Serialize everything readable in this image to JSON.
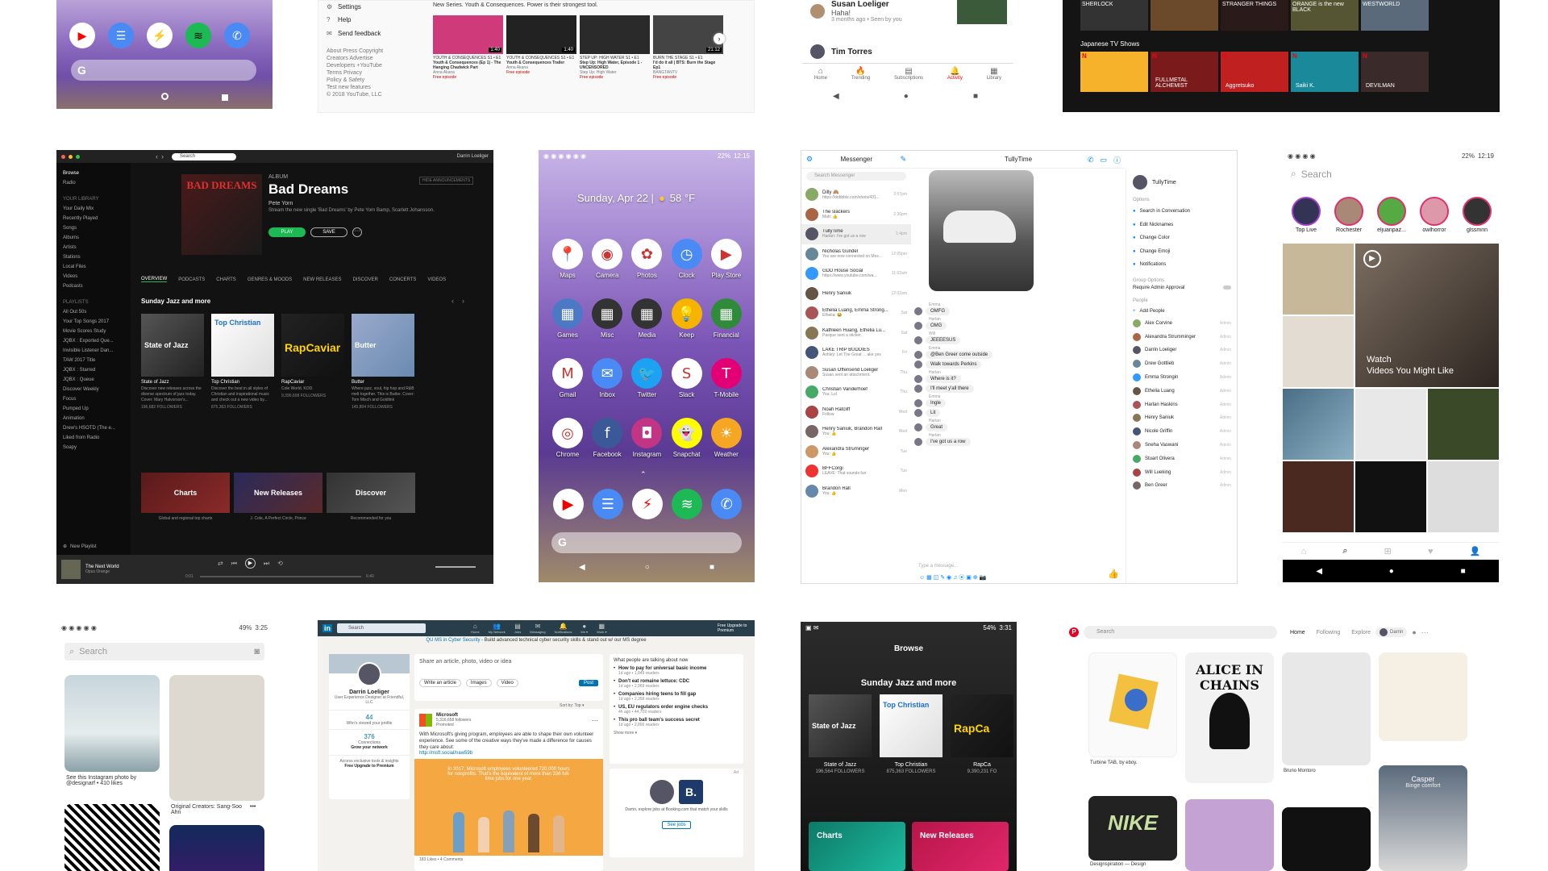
{
  "tile_a": {
    "dock": [
      "youtube-icon",
      "messages-icon",
      "messenger-icon",
      "spotify-icon",
      "phone-icon"
    ]
  },
  "tile_b": {
    "menu": [
      "Settings",
      "Help",
      "Send feedback"
    ],
    "footer": [
      "About  Press  Copyright",
      "Creators  Advertise",
      "Developers  +YouTube",
      "Terms  Privacy",
      "Policy & Safety",
      "Test new features",
      "© 2018 YouTube, LLC"
    ],
    "intro": "New Series. Youth & Consequences. Power is their strongest tool.",
    "videos": [
      {
        "title": "YOUTH & CONSEQUENCES S1 • E1",
        "sub": "Youth & Consequences (Ep 1) - The Hanging Chadwick Part",
        "by": "Anna Akana",
        "badge": "Free episode",
        "dur": "1:40"
      },
      {
        "title": "YOUTH & CONSEQUENCES S1 • E1",
        "sub": "Youth & Consequences Trailer",
        "by": "Anna Akana",
        "badge": "Free episode",
        "dur": "1:40"
      },
      {
        "title": "STEP UP: HIGH WATER S1 • E1",
        "sub": "Step Up: High Water, Episode 1 - UNCENSORED",
        "by": "Step Up: High Water",
        "badge": "Free episode",
        "dur": ""
      },
      {
        "title": "BURN THE STAGE S1 • E1",
        "sub": "I'd do it all | BTS: Burn the Stage Ep1",
        "by": "BANGTANTV",
        "badge": "Free episode",
        "dur": "21:12"
      }
    ]
  },
  "tile_c": {
    "top_name": "Susan Loeliger",
    "top_msg": "Haha!",
    "top_time": "3 months ago • Seen by you",
    "second_name": "Tim Torres",
    "nav": [
      "Home",
      "Trending",
      "Subscriptions",
      "Activity",
      "Library"
    ]
  },
  "tile_d": {
    "row1": [
      "SHERLOCK",
      "",
      "STRANGER THINGS",
      "ORANGE is the new BLACK",
      "WESTWORLD"
    ],
    "section": "Japanese TV Shows",
    "row2": [
      "",
      "FULLMETAL ALCHEMIST",
      "Aggretsuko",
      "Saiki K.",
      "DEVILMAN"
    ]
  },
  "spotify": {
    "search_ph": "Search",
    "user": "Darrin Loeliger",
    "left": [
      "Browse",
      "Radio"
    ],
    "library_h": "YOUR LIBRARY",
    "library": [
      "Your Daily Mix",
      "Recently Played",
      "Songs",
      "Albums",
      "Artists",
      "Stations",
      "Local Files",
      "Videos",
      "Podcasts"
    ],
    "playlists_h": "PLAYLISTS",
    "playlists": [
      "All Out 50s",
      "Your Top Songs 2017",
      "Movie Scores Study",
      "JQBX : Exported Que...",
      "Invisible Listener Dan...",
      "TAW 2017 Title",
      "JQBX : Starred",
      "JQBX : Queue",
      "Discover Weekly",
      "Focus",
      "Pumped Up",
      "Animation",
      "Drew's HSOTD (The e...",
      "Liked from Radio",
      "Soapy"
    ],
    "new_playlist": "New Playlist",
    "album_label": "ALBUM",
    "album_title": "Bad Dreams",
    "album_art_text": "BAD DREAMS",
    "artist": "Pete Yorn",
    "desc": "Stream the new single 'Bad Dreams' by Pete Yorn Bamp, Scarlett Johansson.",
    "play": "PLAY",
    "save": "SAVE",
    "hide": "HIDE ANNOUNCEMENTS",
    "tabs": [
      "OVERVIEW",
      "PODCASTS",
      "CHARTS",
      "GENRES & MOODS",
      "NEW RELEASES",
      "DISCOVER",
      "CONCERTS",
      "VIDEOS"
    ],
    "section": "Sunday Jazz and more",
    "cards": [
      {
        "name": "State of Jazz",
        "desc": "Discover new releases across the diverse spectrum of jazz today. Cover: Mary Halvorson's...",
        "f": "196,682 FOLLOWERS"
      },
      {
        "name": "Top Christian",
        "desc": "Discover the best in all styles of Christian and inspirational music and check out a new video by...",
        "f": "875,363 FOLLOWERS"
      },
      {
        "name": "RapCaviar",
        "desc": "Cole World. KOD.",
        "f": "9,390,608 FOLLOWERS"
      },
      {
        "name": "Butter",
        "desc": "Where jazz, soul, hip hop and R&B melt together. This is Butter. Cover: Tom Misch and Goldlink",
        "f": "145,804 FOLLOWERS"
      }
    ],
    "banners": [
      {
        "t": "Charts",
        "s": "Global and regional top charts"
      },
      {
        "t": "New Releases",
        "s": "J. Cole, A Perfect Circle, Prince"
      },
      {
        "t": "Discover",
        "s": "Recommended for you"
      }
    ],
    "now_title": "The Next World",
    "now_artist": "Opus Orange",
    "t_start": "0:01",
    "t_end": "6:40"
  },
  "android": {
    "status_time": "12:15",
    "status_batt": "22%",
    "date": "Sunday, Apr 22 |",
    "weather": "58 °F",
    "apps": [
      {
        "n": "Maps",
        "c": "#fff",
        "i": "maps-icon",
        "g": "📍"
      },
      {
        "n": "Camera",
        "c": "#fff",
        "i": "camera-icon",
        "g": "◉"
      },
      {
        "n": "Photos",
        "c": "#fff",
        "i": "photos-icon",
        "g": "✿"
      },
      {
        "n": "Clock",
        "c": "#4a8af4",
        "i": "clock-icon",
        "g": "◷"
      },
      {
        "n": "Play Store",
        "c": "#fff",
        "i": "play-store-icon",
        "g": "▶"
      },
      {
        "n": "Games",
        "c": "#4b79c6",
        "i": "games-folder-icon",
        "g": "▦"
      },
      {
        "n": "Misc",
        "c": "#333",
        "i": "misc-folder-icon",
        "g": "▦"
      },
      {
        "n": "Media",
        "c": "#333",
        "i": "media-folder-icon",
        "g": "▦"
      },
      {
        "n": "Keep",
        "c": "#f6b400",
        "i": "keep-icon",
        "g": "💡"
      },
      {
        "n": "Financial",
        "c": "#2f8a3a",
        "i": "financial-folder-icon",
        "g": "▦"
      },
      {
        "n": "Gmail",
        "c": "#fff",
        "i": "gmail-icon",
        "g": "M"
      },
      {
        "n": "Inbox",
        "c": "#4a8af4",
        "i": "inbox-icon",
        "g": "✉"
      },
      {
        "n": "Twitter",
        "c": "#1da1f2",
        "i": "twitter-icon",
        "g": "🐦"
      },
      {
        "n": "Slack",
        "c": "#fff",
        "i": "slack-icon",
        "g": "S"
      },
      {
        "n": "T-Mobile",
        "c": "#e20074",
        "i": "tmobile-icon",
        "g": "T"
      },
      {
        "n": "Chrome",
        "c": "#fff",
        "i": "chrome-icon",
        "g": "◎"
      },
      {
        "n": "Facebook",
        "c": "#3b5998",
        "i": "facebook-icon",
        "g": "f"
      },
      {
        "n": "Instagram",
        "c": "#c13584",
        "i": "instagram-icon",
        "g": "◘"
      },
      {
        "n": "Snapchat",
        "c": "#fffc00",
        "i": "snapchat-icon",
        "g": "👻"
      },
      {
        "n": "Weather",
        "c": "#f5a623",
        "i": "weather-icon",
        "g": "☀"
      }
    ],
    "dock": [
      {
        "c": "#fff",
        "i": "youtube-icon",
        "g": "▶"
      },
      {
        "c": "#4a8af4",
        "i": "messages-icon",
        "g": "☰"
      },
      {
        "c": "#fff",
        "i": "messenger-icon",
        "g": "⚡"
      },
      {
        "c": "#1db954",
        "i": "spotify-icon",
        "g": "≋"
      },
      {
        "c": "#4a8af4",
        "i": "phone-icon",
        "g": "✆"
      }
    ]
  },
  "messenger": {
    "title": "Messenger",
    "search_ph": "Search Messenger",
    "convo_title": "TullyTime",
    "convos": [
      {
        "n": "Dilly 🙈",
        "m": "https://dribbble.com/shots/431...",
        "t": "2:57pm"
      },
      {
        "n": "The slackers",
        "m": "Matt: 👍",
        "t": "2:36pm"
      },
      {
        "n": "TullyTime",
        "m": "Harlan: I've got us a row",
        "t": "1:4pm"
      },
      {
        "n": "Nicholas Gundel",
        "m": "You are now connected on Mes...",
        "t": "12:05pm"
      },
      {
        "n": "GDD House Social",
        "m": "https://www.youtube.com/wa...",
        "t": "11:02am"
      },
      {
        "n": "Henry Saniuk",
        "m": "",
        "t": "12:02am"
      },
      {
        "n": "Ethelia Luang, Emma Strong...",
        "m": "Ethelia: 😂",
        "t": "Sat"
      },
      {
        "n": "Kathleen Huang, Ethelia Lu...",
        "m": "Pasque sent a sticker.",
        "t": "Sat"
      },
      {
        "n": "LAKE TRIP BUDDIES",
        "m": "Ashley: Let The Great ... ake yes",
        "t": "Fri"
      },
      {
        "n": "Susan Offensend Loeliger",
        "m": "Susan sent an attachment.",
        "t": "Thu"
      },
      {
        "n": "Christian Vanderhoef",
        "m": "You: Lol",
        "t": "Thu"
      },
      {
        "n": "Noah Ratcliff",
        "m": "Follow",
        "t": "Wed"
      },
      {
        "n": "Henry Saniuk, Brandon Rall",
        "m": "You: 👍",
        "t": "Wed"
      },
      {
        "n": "Alexandra Struminger",
        "m": "You: 👍",
        "t": "Tue"
      },
      {
        "n": "BFFCorgi",
        "m": "LEAVE: That sounds fun",
        "t": "Tue"
      },
      {
        "n": "Brandon Rall",
        "m": "You: 👍",
        "t": "Mon"
      }
    ],
    "chat": [
      {
        "who": "Emma",
        "text": "OMFG"
      },
      {
        "who": "Harlan",
        "text": "OMG"
      },
      {
        "who": "Will",
        "text": "JEEEESUS"
      },
      {
        "who": "Emma",
        "text": "@Ben Greer come outside"
      },
      {
        "who": "",
        "text": "Walk towards Perkins"
      },
      {
        "who": "Harlan",
        "text": "Where is it?"
      },
      {
        "who": "",
        "text": "I'll meet y'all there"
      },
      {
        "who": "Emma",
        "text": "Ingle"
      },
      {
        "who": "",
        "text": "Lit"
      },
      {
        "who": "Harlan",
        "text": "Great"
      },
      {
        "who": "Harlan",
        "text": "I've got us a row"
      }
    ],
    "compose_ph": "Type a message...",
    "info_name": "TullyTime",
    "options_h": "Options",
    "options": [
      "Search in Conversation",
      "Edit Nicknames",
      "Change Color",
      "Change Emoji",
      "Notifications"
    ],
    "group_h": "Group Options",
    "require": "Require Admin Approval",
    "people_h": "People",
    "add": "Add People",
    "people": [
      "Alex Corvine",
      "Alexandra Strumminger",
      "Darrin Loeliger",
      "Drew Gottlieb",
      "Emma Strongin",
      "Ethelia Luang",
      "Harlan Haskins",
      "Henry Saniuk",
      "Nicole Griffin",
      "Sneha Vaswani",
      "Stuart Olivera",
      "Will Lueking",
      "Ben Greer"
    ],
    "admin": "Admin"
  },
  "instagram": {
    "status_batt": "22%",
    "status_time": "12:19",
    "search_ph": "Search",
    "stories": [
      "Top Live",
      "Rochester",
      "eljuanpaz...",
      "owlhorror",
      "glssmnn"
    ],
    "watch_1": "Watch",
    "watch_2": "Videos You Might Like",
    "nav": [
      "home-icon",
      "search-icon",
      "add-icon",
      "heart-icon",
      "profile-icon"
    ]
  },
  "pinterest_android": {
    "status_batt": "49%",
    "status_time": "3:25",
    "search_ph": "Search",
    "cap1": "See this Instagram photo by @designarf • 410 likes",
    "cap2": "Original Creators: Sang-Soo Ahn",
    "more": "•••"
  },
  "linkedin": {
    "search_ph": "Search",
    "nav": [
      "Home",
      "My Network",
      "Jobs",
      "Messaging",
      "Notifications",
      "Me ▾",
      "Work ▾"
    ],
    "upgrade": "Free Upgrade to Premium",
    "ad_prefix": "QU MS in Cyber Security",
    "ad_text": "- Build advanced technical cyber security skills & stand out w/ our MS degree",
    "ad_label": "Ad",
    "name": "Darrin Loeliger",
    "role": "User Experience Designer at Friendful, LLC",
    "views_n": "44",
    "views_l": "Who's viewed your profile",
    "conn_n": "376",
    "conn_l": "Connections",
    "conn_s": "Grow your network",
    "premium_1": "Access exclusive tools & insights",
    "premium_2": "Free Upgrade to Premium",
    "share_ph": "Share an article, photo, video or idea",
    "write": "Write an article",
    "images": "Images",
    "video": "Video",
    "post": "Post",
    "sort": "Sort by: Top ▾",
    "co": "Microsoft",
    "co_f": "5,316,658 followers",
    "co_p": "Promoted",
    "post_text": "With Microsoft's giving program, employees are able to shape their own volunteer experience. See some of the creative ways they've made a difference for causes they care about:",
    "post_link": "http://msft.social/naw59b",
    "img_text": "In 2017, Microsoft employees volunteered 720,000 hours for nonprofits. That's the equivalent of more than 336 full-time jobs for one year.",
    "news_h": "What people are talking about now",
    "news": [
      {
        "t": "How to pay for universal basic income",
        "s": "1d ago • 1,849 readers"
      },
      {
        "t": "Don't eat romaine lettuce: CDC",
        "s": "1d ago • 2,969 readers"
      },
      {
        "t": "Companies hiring teens to fill gap",
        "s": "1d ago • 2,358 readers"
      },
      {
        "t": "US, EU regulators order engine checks",
        "s": "4h ago • 44,709 readers"
      },
      {
        "t": "This pro ball team's success secret",
        "s": "1d ago • 2,800 readers"
      }
    ],
    "show_more": "Show more ▾",
    "job_text": "Darrin, explore jobs at Booking.com that match your skills",
    "job_btn": "See jobs",
    "likes": "183 Likes • 4 Comments"
  },
  "spotify_mobile": {
    "status_batt": "54%",
    "status_time": "3:31",
    "title": "Browse",
    "section": "Sunday Jazz and more",
    "cards": [
      {
        "n": "State of Jazz",
        "f": "196,564 FOLLOWERS"
      },
      {
        "n": "Top Christian",
        "f": "875,363 FOLLOWERS"
      },
      {
        "n": "RapCa",
        "f": "9,390,231 FO"
      }
    ],
    "charts": "Charts",
    "new": "New Releases"
  },
  "pinterest_web": {
    "search_ph": "Search",
    "nav": [
      "Home",
      "Following",
      "Explore"
    ],
    "user": "Darrin",
    "cap1": "Turbine TAB, by eboy.",
    "cap2": "Bruno Montoro",
    "cap3": "Designspiration — Design",
    "casper_1": "Casper",
    "casper_2": "Binge comfort",
    "poster": "ALICE IN CHAINS",
    "nike": "NIKE"
  },
  "colors": {
    "spotify_green": "#1db954",
    "fb_blue": "#0084ff",
    "li_blue": "#0073b1",
    "pin_red": "#e60023",
    "yt_red": "#ff0000"
  }
}
